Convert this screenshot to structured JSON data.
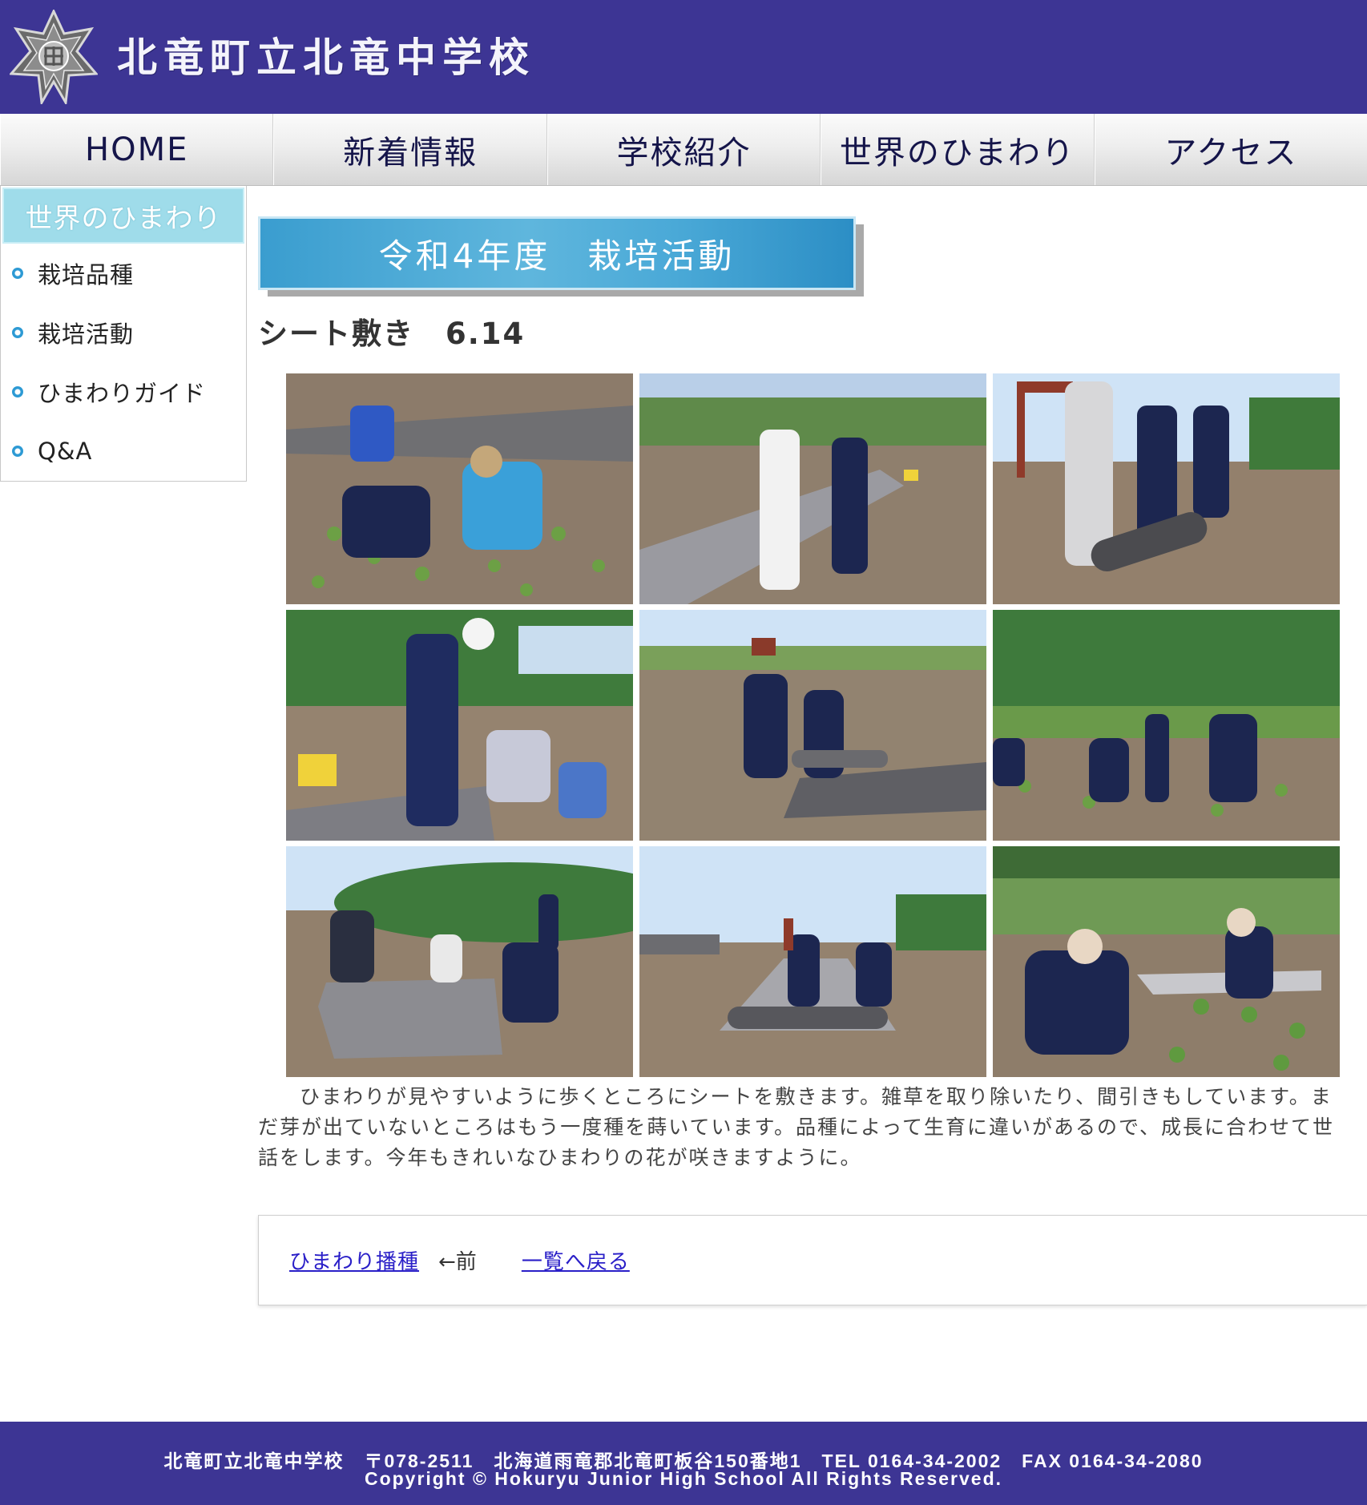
{
  "header": {
    "site_title": "北竜町立北竜中学校",
    "emblem_icon": "school-emblem-icon"
  },
  "nav": {
    "items": [
      {
        "label": "HOME"
      },
      {
        "label": "新着情報"
      },
      {
        "label": "学校紹介"
      },
      {
        "label": "世界のひまわり"
      },
      {
        "label": "アクセス"
      }
    ]
  },
  "sidebar": {
    "title": "世界のひまわり",
    "items": [
      {
        "label": "栽培品種"
      },
      {
        "label": "栽培活動"
      },
      {
        "label": "ひまわりガイド"
      },
      {
        "label": "Q&A"
      }
    ]
  },
  "main": {
    "heading": "令和4年度　栽培活動",
    "article_title": "シート敷き　6.14",
    "photo_count": 9,
    "body": "ひまわりが見やすいように歩くところにシートを敷きます。雑草を取り除いたり、間引きもしています。まだ芽が出ていないところはもう一度種を蒔いています。品種によって生育に違いがあるので、成長に合わせて世話をします。今年もきれいなひまわりの花が咲きますように。"
  },
  "pager": {
    "prev_link": "ひまわり播種",
    "prev_mark": "←前",
    "list_link": "一覧へ戻る"
  },
  "footer": {
    "address_line": "北竜町立北竜中学校　〒078-2511　北海道雨竜郡北竜町板谷150番地1　TEL 0164-34-2002　FAX 0164-34-2080",
    "copyright": "Copyright © Hokuryu Junior High School All Rights Reserved."
  },
  "colors": {
    "header_bg": "#3d3594",
    "heading_blue": "#3a9dcf",
    "sidebar_title_bg": "#9fdcea",
    "link": "#2a1fc8"
  }
}
